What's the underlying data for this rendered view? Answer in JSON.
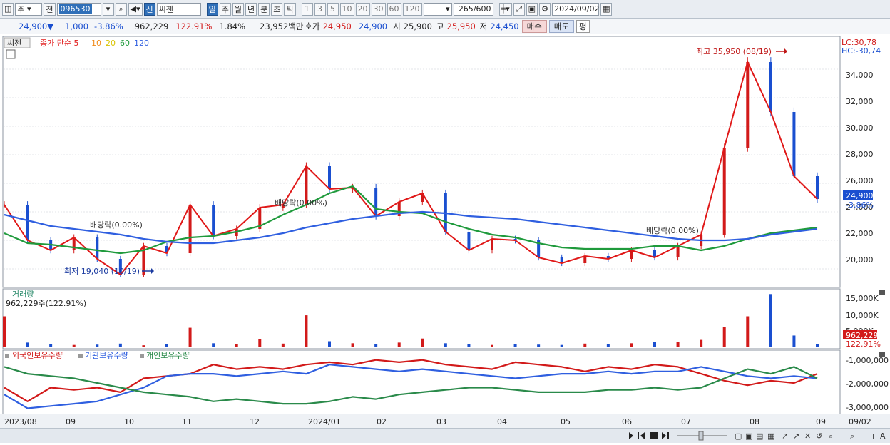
{
  "toolbar": {
    "period_label": "주",
    "prev_label": "전",
    "code": "096530",
    "new_badge": "신",
    "stock_name": "씨젠",
    "period_buttons": [
      "일",
      "주",
      "월",
      "년",
      "분",
      "초",
      "틱"
    ],
    "tick_numbers": [
      "1",
      "3",
      "5",
      "10",
      "20",
      "30",
      "60",
      "120"
    ],
    "count": "265",
    "count_total": "/600",
    "date": "2024/09/02"
  },
  "quote": {
    "price": "24,900",
    "arrow": "▼",
    "change": "1,000",
    "change_pct": "-3.86%",
    "volume": "962,229",
    "volume_pct": "122.91%",
    "turnover": "1.84%",
    "amount": "23,952백만",
    "ask_label": "호가",
    "ask": "24,950",
    "bid": "24,900",
    "open_label": "시",
    "open": "25,900",
    "high_label": "고",
    "high": "25,950",
    "low_label": "저",
    "low": "24,450",
    "buy_label": "매수",
    "sell_label": "매도",
    "avg_label": "평"
  },
  "price_panel": {
    "stock_tag": "씨젠",
    "legend": [
      "종가 단순 5",
      "10",
      "20",
      "60",
      "120"
    ],
    "legend_colors": [
      "#e01818",
      "#f08a18",
      "#f5e21a",
      "#1f9a3c",
      "#2f5fe0"
    ],
    "lc": "LC:30,78",
    "hc": "HC:-30,74",
    "y_ticks": [
      "34,000",
      "32,000",
      "30,000",
      "28,000",
      "26,000",
      "24,000",
      "22,000",
      "20,000"
    ],
    "last_price": "24,900",
    "last_change": "-3.86%",
    "max_note": "최고 35,950 (08/19)",
    "min_note": "최저 19,040 (10/19)",
    "dividend_notes": [
      "배당락(0.00%)",
      "배당락(0.00%)",
      "배당락(0.00%)"
    ]
  },
  "volume_panel": {
    "title": "거래량",
    "value": "962,229주(122.91%)",
    "y_ticks": [
      "15,000K",
      "10,000K",
      "5,000K"
    ],
    "last_value": "962,229",
    "last_pct": "122.91%"
  },
  "holdings_panel": {
    "legend": [
      "외국인보유수량",
      "기관보유수량",
      "개인보유수량"
    ],
    "legend_colors": [
      "#d21a1a",
      "#2f5fe0",
      "#2a8a4a"
    ],
    "y_ticks": [
      "-1,000,000",
      "-2,000,000",
      "-3,000,000"
    ]
  },
  "x_axis": [
    "2023/08",
    "09",
    "10",
    "11",
    "12",
    "2024/01",
    "02",
    "03",
    "04",
    "05",
    "06",
    "07",
    "08",
    "09"
  ],
  "x_axis_right": "09/02",
  "chart_data": {
    "type": "line",
    "unit": "KRW",
    "x": [
      "2023/08",
      "09",
      "10",
      "11",
      "12",
      "2024/01",
      "02",
      "03",
      "04",
      "05",
      "06",
      "07",
      "08",
      "09"
    ],
    "ylim": [
      18800,
      36200
    ],
    "series": [
      {
        "name": "종가",
        "values": [
          24500,
          22000,
          21300,
          22200,
          20700,
          19600,
          21600,
          21100,
          24500,
          22300,
          22800,
          24300,
          24500,
          27200,
          25600,
          25700,
          23700,
          24700,
          25300,
          22600,
          21300,
          22100,
          22000,
          20800,
          20400,
          20900,
          20700,
          21300,
          20800,
          21600,
          22400,
          28500,
          34500,
          31000,
          26500,
          24900
        ]
      },
      {
        "name": "60",
        "values": [
          22500,
          21800,
          21700,
          21500,
          21300,
          21100,
          21300,
          21900,
          22200,
          22300,
          22600,
          23000,
          23800,
          24500,
          25300,
          25800,
          24200,
          24000,
          23900,
          23300,
          22800,
          22400,
          22200,
          21800,
          21500,
          21400,
          21400,
          21400,
          21600,
          21600,
          21300,
          21600,
          22100,
          22500,
          22700,
          22900
        ]
      },
      {
        "name": "120",
        "values": [
          23800,
          23400,
          23000,
          22800,
          22600,
          22400,
          22100,
          21900,
          21800,
          21800,
          22000,
          22200,
          22500,
          22900,
          23200,
          23500,
          23700,
          23900,
          24000,
          23900,
          23700,
          23600,
          23500,
          23300,
          23100,
          22900,
          22700,
          22500,
          22300,
          22100,
          22000,
          22000,
          22100,
          22400,
          22600,
          22800
        ]
      }
    ],
    "volume_K": [
      9200,
      1400,
      900,
      700,
      800,
      1100,
      600,
      1000,
      5800,
      1200,
      900,
      2500,
      1100,
      9500,
      1800,
      1200,
      900,
      1400,
      2600,
      1200,
      1000,
      700,
      900,
      800,
      700,
      1100,
      900,
      1200,
      1500,
      1600,
      2200,
      6000,
      9200,
      15800,
      3500,
      962
    ],
    "holdings": [
      {
        "name": "외국인보유수량",
        "values": [
          -2200000,
          -2800000,
          -2200000,
          -2300000,
          -2200000,
          -2400000,
          -1800000,
          -1700000,
          -1600000,
          -1200000,
          -1400000,
          -1300000,
          -1400000,
          -1200000,
          -1100000,
          -1200000,
          -1000000,
          -1100000,
          -1000000,
          -1200000,
          -1300000,
          -1400000,
          -1100000,
          -1200000,
          -1300000,
          -1500000,
          -1300000,
          -1400000,
          -1200000,
          -1300000,
          -1600000,
          -1900000,
          -2100000,
          -1900000,
          -2000000,
          -1600000
        ]
      },
      {
        "name": "기관보유수량",
        "values": [
          -2500000,
          -3100000,
          -3000000,
          -2900000,
          -2800000,
          -2500000,
          -2200000,
          -1700000,
          -1600000,
          -1600000,
          -1700000,
          -1600000,
          -1500000,
          -1600000,
          -1200000,
          -1300000,
          -1400000,
          -1500000,
          -1400000,
          -1500000,
          -1600000,
          -1700000,
          -1800000,
          -1700000,
          -1600000,
          -1600000,
          -1500000,
          -1600000,
          -1500000,
          -1500000,
          -1300000,
          -1500000,
          -1700000,
          -1800000,
          -1700000,
          -1800000
        ]
      },
      {
        "name": "개인보유수량",
        "values": [
          -1300000,
          -1600000,
          -1700000,
          -1800000,
          -2000000,
          -2200000,
          -2400000,
          -2500000,
          -2600000,
          -2800000,
          -2700000,
          -2800000,
          -2900000,
          -2900000,
          -2800000,
          -2600000,
          -2700000,
          -2500000,
          -2400000,
          -2300000,
          -2200000,
          -2200000,
          -2300000,
          -2400000,
          -2400000,
          -2400000,
          -2300000,
          -2300000,
          -2200000,
          -2300000,
          -2200000,
          -1800000,
          -1400000,
          -1600000,
          -1300000,
          -1800000
        ]
      }
    ]
  }
}
